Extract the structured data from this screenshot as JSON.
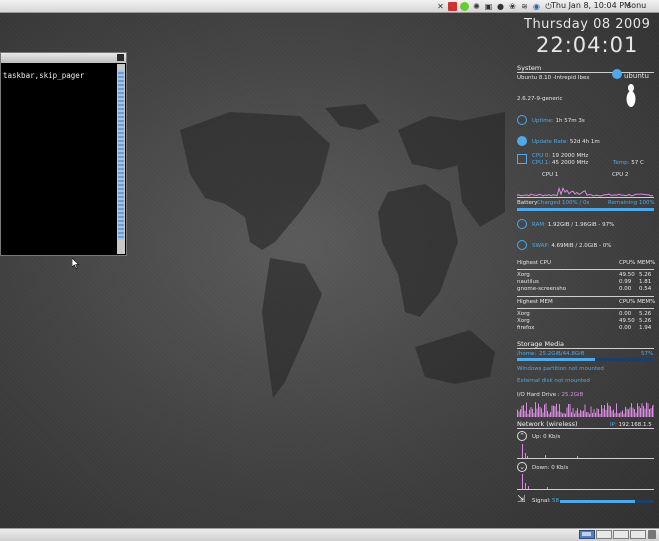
{
  "top_panel": {
    "clock": "Thu Jan  8, 10:04 PM",
    "user": "sonu",
    "tray_icons": [
      "tools-icon",
      "network-manager-icon",
      "update-notifier-icon",
      "gear-icon",
      "lock-icon",
      "record-icon",
      "paw-icon",
      "wifi-icon",
      "volume-icon",
      "power-icon"
    ]
  },
  "terminal": {
    "text": "taskbar,skip_pager"
  },
  "conky": {
    "date": "Thursday 08 2009",
    "time": "22:04:01",
    "system": {
      "header": "System",
      "os": "Ubuntu 8.10 -Intrepid Ibex",
      "kernel": "2.6.27-9-generic",
      "logo_text": "ubuntu",
      "uptime_label": "Uptime:",
      "uptime_value": "1h 57m 3s",
      "update_label": "Update Rate:",
      "update_value": "52d 4h 1m",
      "cpu0_label": "CPU 0:",
      "cpu0_pct": "19",
      "cpu0_freq": "2000 MHz",
      "cpu1_label": "CPU 1:",
      "cpu1_pct": "45",
      "cpu1_freq": "2000 MHz",
      "temp_label": "Temp:",
      "temp_value": "57 C",
      "cpu1_graph_label": "CPU 1",
      "cpu2_graph_label": "CPU 2",
      "battery_label": "Battery",
      "battery_status": "Charged 100% / 0s",
      "battery_right": "Remaining 100%",
      "battery_level": 1.0,
      "ram_label": "RAM:",
      "ram_value": "1.92GiB / 1.96GiB - 97%",
      "ram_level": 0.97,
      "swap_label": "SWAP:",
      "swap_value": "4.69MiB / 2.0GiB - 0%",
      "swap_level": 0.0
    },
    "top_cpu": {
      "header": "Highest CPU",
      "col": "CPU% MEM%",
      "rows": [
        {
          "name": "Xorg",
          "cpu": "49.50",
          "mem": "5.26"
        },
        {
          "name": "nautilus",
          "cpu": "0.99",
          "mem": "1.81"
        },
        {
          "name": "gnome-screensho",
          "cpu": "0.00",
          "mem": "0.54"
        }
      ]
    },
    "top_mem": {
      "header": "Highest MEM",
      "col": "CPU% MEM%",
      "rows": [
        {
          "name": "Xorg",
          "cpu": "0.00",
          "mem": "5.26"
        },
        {
          "name": "Xorg",
          "cpu": "49.50",
          "mem": "5.26"
        },
        {
          "name": "firefox",
          "cpu": "0.00",
          "mem": "1.94"
        }
      ]
    },
    "storage": {
      "header": "Storage Media",
      "root_label": "/home:",
      "root_value": "25.2GiB/44.8GiB",
      "root_pct": "57%",
      "root_level": 0.57,
      "win_msg": "Windows partition not mounted",
      "ext_msg": "External disk not mounted",
      "io_label": "I/O Hard Drive :",
      "io_value": "25.2GiB"
    },
    "network": {
      "header": "Network (wireless)",
      "ip_label": "IP:",
      "ip_value": "192.168.1.5",
      "up_label": "Up:",
      "up_value": "0 Kb/s",
      "down_label": "Down:",
      "down_value": "0 Kb/s",
      "signal_label": "Signal:",
      "signal_value": "58",
      "signal_level": 0.8
    },
    "colors": {
      "accent": "#4fa9e8",
      "graph": "#d98be0",
      "text": "#e6e6e6"
    }
  }
}
